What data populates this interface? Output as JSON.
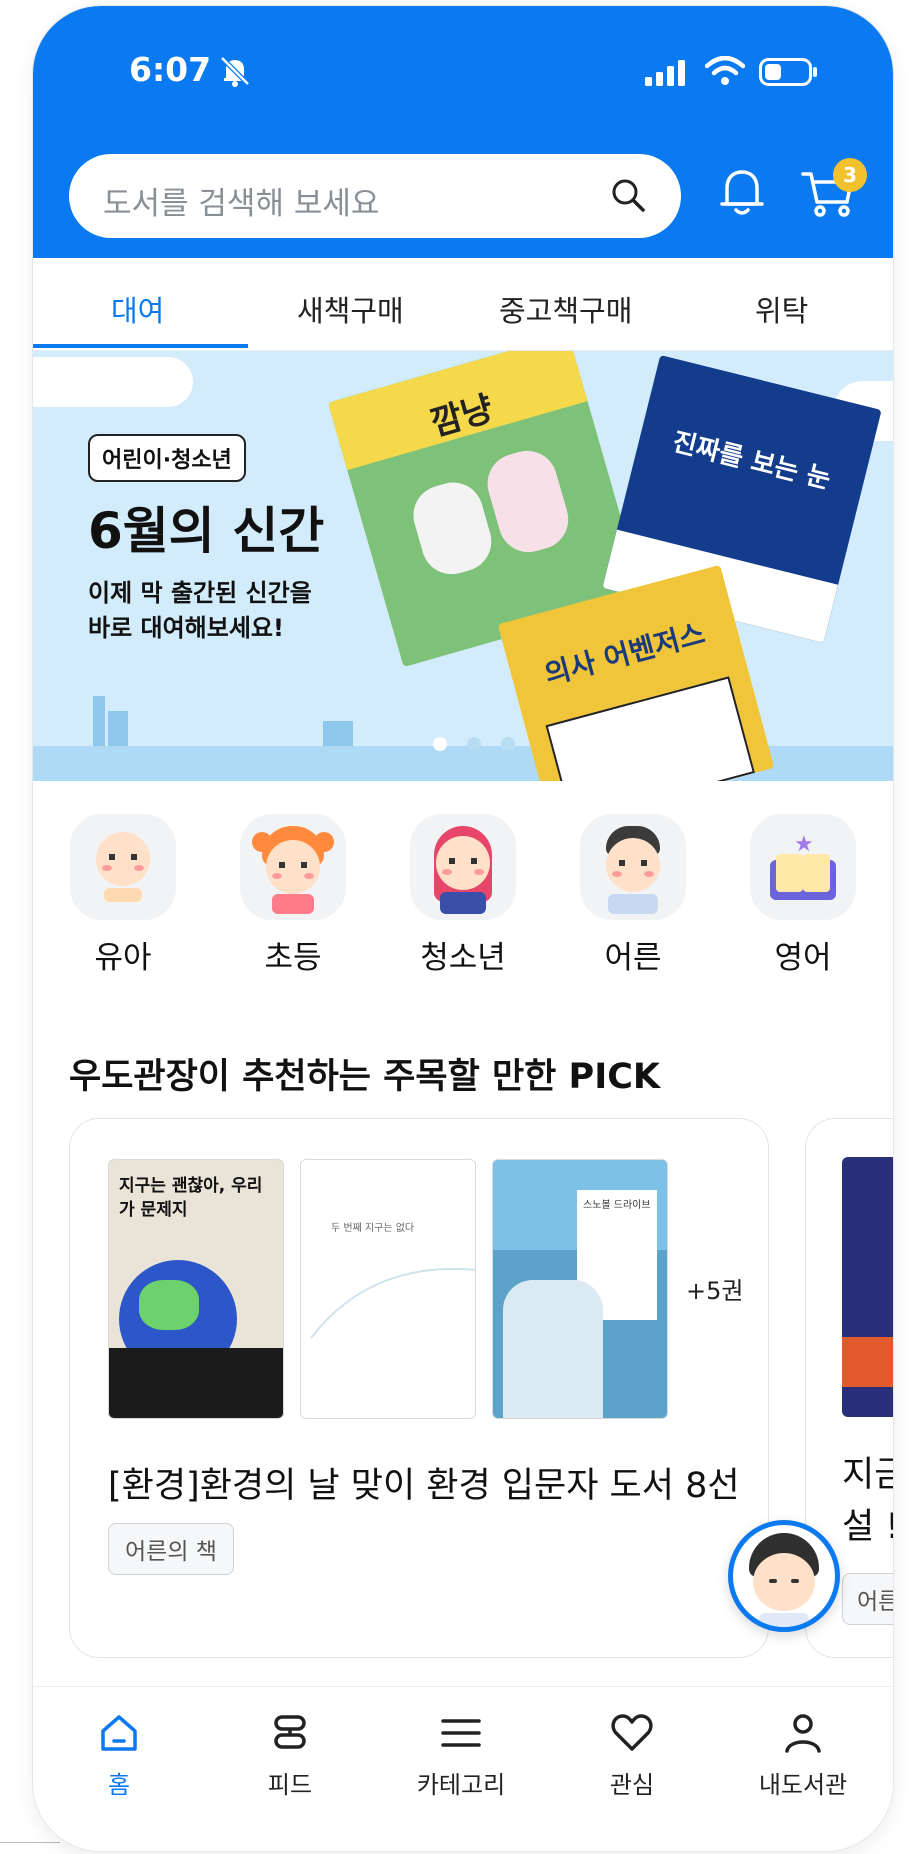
{
  "status_bar": {
    "time": "6:07"
  },
  "header": {
    "search_placeholder": "도서를 검색해 보세요",
    "cart_badge": "3"
  },
  "tabs": [
    {
      "label": "대여",
      "active": true
    },
    {
      "label": "새책구매",
      "active": false
    },
    {
      "label": "중고책구매",
      "active": false
    },
    {
      "label": "위탁",
      "active": false
    }
  ],
  "banner": {
    "tag": "어린이·청소년",
    "title": "6월의 신간",
    "subtitle": "이제 막 출간된 신간을\n바로 대여해보세요!",
    "books": [
      "깜냥",
      "진짜를 보는 눈",
      "의사 어벤저스"
    ],
    "slide_count": 3,
    "active_slide": 1
  },
  "categories": [
    {
      "label": "유아",
      "icon": "baby-icon"
    },
    {
      "label": "초등",
      "icon": "girl-icon"
    },
    {
      "label": "청소년",
      "icon": "teen-icon"
    },
    {
      "label": "어른",
      "icon": "adult-icon"
    },
    {
      "label": "영어",
      "icon": "english-book-icon"
    }
  ],
  "pick_section": {
    "title": "우도관장이 추천하는 주목할 만한 PICK",
    "cards": [
      {
        "books": [
          "지구는 괜찮아, 우리가 문제지",
          "두 번째 지구는 없다",
          "스노볼 드라이브"
        ],
        "more": "+5권",
        "title": "[환경]환경의 날 맞이 환경 입문자 도서 8선",
        "tag": "어른의 책"
      },
      {
        "title": "지금\n설 !",
        "tag": "어른"
      }
    ]
  },
  "bottom_nav": [
    {
      "label": "홈",
      "icon": "home-icon",
      "active": true
    },
    {
      "label": "피드",
      "icon": "feed-icon",
      "active": false
    },
    {
      "label": "카테고리",
      "icon": "menu-icon",
      "active": false
    },
    {
      "label": "관심",
      "icon": "heart-icon",
      "active": false
    },
    {
      "label": "내도서관",
      "icon": "person-icon",
      "active": false
    }
  ],
  "colors": {
    "primary": "#0b7af0",
    "badge": "#f2c12e",
    "banner_bg": "#d3ecfb"
  }
}
